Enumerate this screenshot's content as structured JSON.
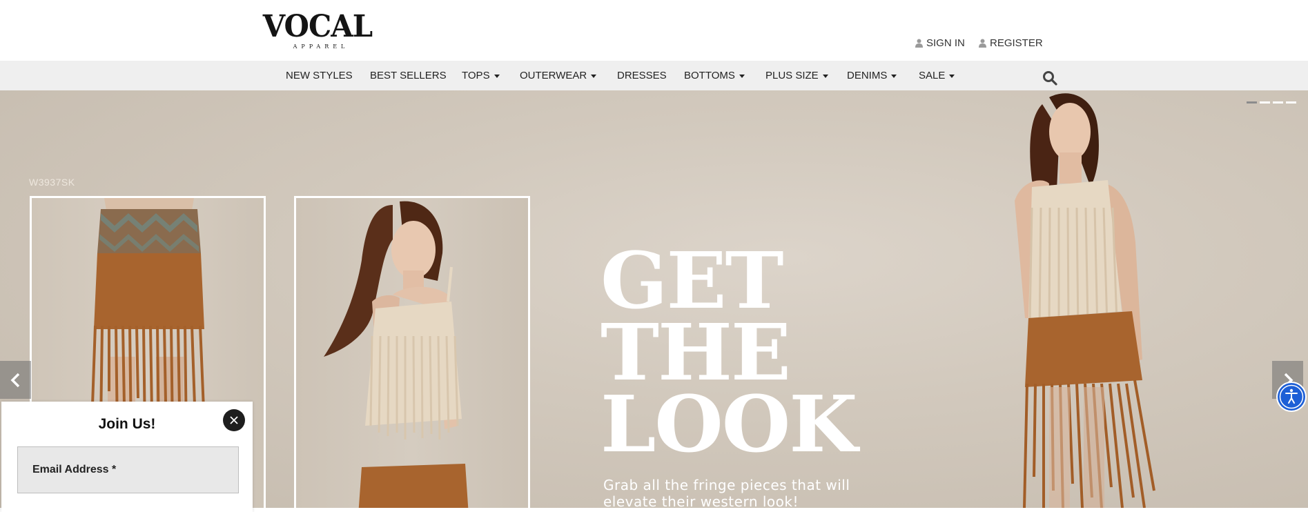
{
  "header": {
    "logo_main": "VOCAL",
    "logo_sub": "APPAREL",
    "sign_in": "SIGN IN",
    "register": "REGISTER"
  },
  "nav": {
    "items": [
      {
        "label": "NEW STYLES",
        "dropdown": false
      },
      {
        "label": "BEST SELLERS",
        "dropdown": false
      },
      {
        "label": "TOPS",
        "dropdown": true
      },
      {
        "label": "OUTERWEAR",
        "dropdown": true
      },
      {
        "label": "DRESSES",
        "dropdown": false
      },
      {
        "label": "BOTTOMS",
        "dropdown": true
      },
      {
        "label": "PLUS SIZE",
        "dropdown": true
      },
      {
        "label": "DENIMS",
        "dropdown": true
      },
      {
        "label": "SALE",
        "dropdown": true
      }
    ],
    "search_icon": "search-icon"
  },
  "hero": {
    "sku": "W3937SK",
    "headline": [
      "GET",
      "THE",
      "LOOK"
    ],
    "subtext": "Grab all the fringe pieces that will elevate their western look!",
    "slides": 4,
    "active_slide": 1,
    "colors": {
      "fringe_brown": "#a8642e",
      "cream": "#e6d8c3",
      "background": "#d2c9bd"
    }
  },
  "popup": {
    "title": "Join Us!",
    "email_placeholder": "Email Address *"
  },
  "accessibility": {
    "icon": "accessibility-icon",
    "color": "#1d5fd6"
  }
}
